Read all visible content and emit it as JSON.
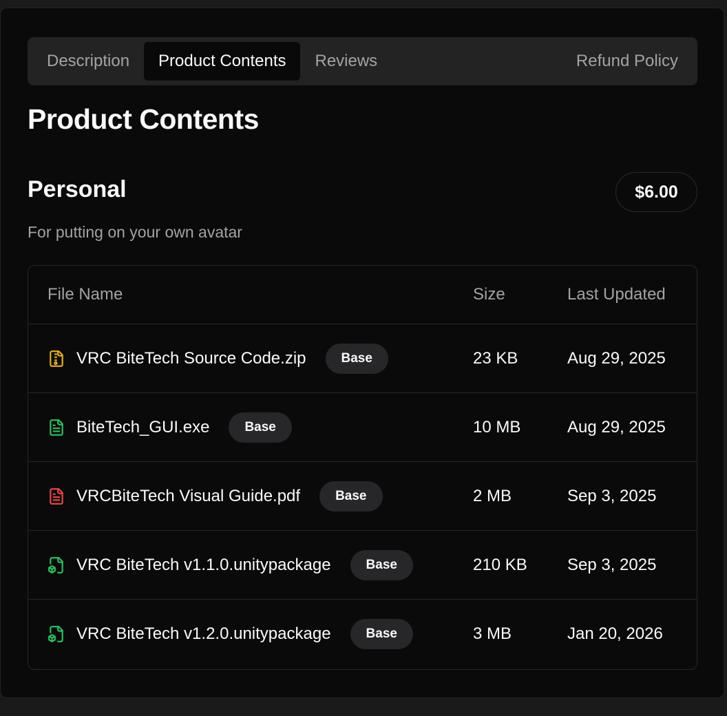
{
  "tabs": [
    {
      "label": "Description",
      "active": false
    },
    {
      "label": "Product Contents",
      "active": true
    },
    {
      "label": "Reviews",
      "active": false
    },
    {
      "label": "Refund Policy",
      "active": false
    }
  ],
  "page_title": "Product Contents",
  "tier": {
    "name": "Personal",
    "price": "$6.00",
    "description": "For putting on your own avatar"
  },
  "table": {
    "headers": {
      "file_name": "File Name",
      "size": "Size",
      "last_updated": "Last Updated"
    },
    "rows": [
      {
        "icon": "zip-file-icon",
        "icon_color": "#eab308",
        "name": "VRC BiteTech Source Code.zip",
        "badge": "Base",
        "size": "23 KB",
        "date": "Aug 29, 2025"
      },
      {
        "icon": "text-file-icon",
        "icon_color": "#22c55e",
        "name": "BiteTech_GUI.exe",
        "badge": "Base",
        "size": "10 MB",
        "date": "Aug 29, 2025"
      },
      {
        "icon": "text-file-icon",
        "icon_color": "#ef4444",
        "name": "VRCBiteTech Visual Guide.pdf",
        "badge": "Base",
        "size": "2 MB",
        "date": "Sep 3, 2025"
      },
      {
        "icon": "package-file-icon",
        "icon_color": "#22c55e",
        "name": "VRC BiteTech v1.1.0.unitypackage",
        "badge": "Base",
        "size": "210 KB",
        "date": "Sep 3, 2025"
      },
      {
        "icon": "package-file-icon",
        "icon_color": "#22c55e",
        "name": "VRC BiteTech v1.2.0.unitypackage",
        "badge": "Base",
        "size": "3 MB",
        "date": "Jan 20, 2026"
      }
    ]
  },
  "colors": {
    "background": "#0a0a0a",
    "tab_bar": "#232323",
    "text_primary": "#fafafa",
    "text_muted": "#a3a3a3",
    "badge": "#27272a"
  }
}
